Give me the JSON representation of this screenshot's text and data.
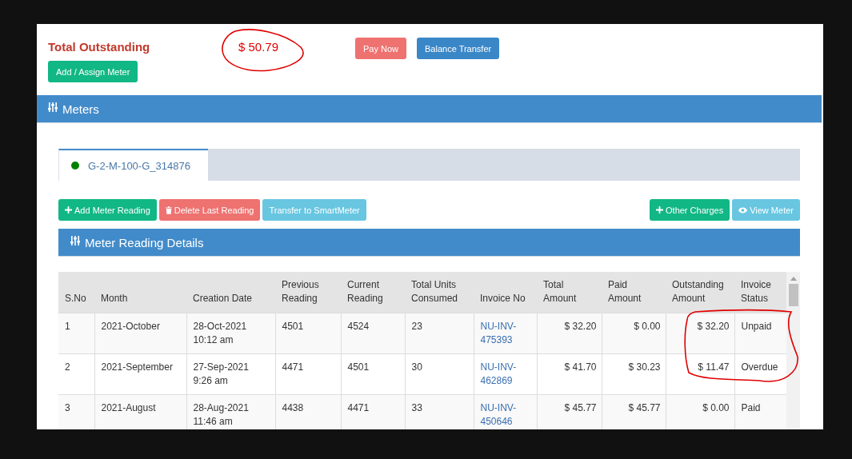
{
  "summary": {
    "label": "Total Outstanding",
    "amount": "$ 50.79"
  },
  "header_buttons": [
    {
      "label": "Pay Now",
      "kind": "danger"
    },
    {
      "label": "Balance Transfer",
      "kind": "primary"
    }
  ],
  "assign_button": "Add / Assign Meter",
  "meters_panel": {
    "title": "Meters"
  },
  "meter_tabs": [
    {
      "label": "G-2-M-100-G_314876",
      "selected": true,
      "color": "#008000"
    }
  ],
  "actions_left": [
    {
      "label": "Add Meter Reading",
      "kind": "success"
    },
    {
      "label": "Delete Last Reading",
      "kind": "danger"
    },
    {
      "label": "Transfer to SmartMeter",
      "kind": "info"
    }
  ],
  "actions_right": [
    {
      "label": "Other Charges",
      "kind": "success"
    },
    {
      "label": "View Meter",
      "kind": "info"
    }
  ],
  "details_panel": {
    "title": "Meter Reading Details"
  },
  "table": {
    "columns": [
      "S.No",
      "Month",
      "Creation Date",
      "Previous Reading",
      "Current Reading",
      "Total Units Consumed",
      "Invoice No",
      "Total Amount",
      "Paid Amount",
      "Outstanding Amount",
      "Invoice Status"
    ],
    "rows": [
      [
        "1",
        "2021-October",
        "28-Oct-2021 10:12 am",
        "4501",
        "4524",
        "23",
        "NU-INV-475393",
        "$ 32.20",
        "$ 0.00",
        "$ 32.20",
        "Unpaid"
      ],
      [
        "2",
        "2021-September",
        "27-Sep-2021 9:26 am",
        "4471",
        "4501",
        "30",
        "NU-INV-462869",
        "$ 41.70",
        "$ 30.23",
        "$ 11.47",
        "Overdue"
      ],
      [
        "3",
        "2021-August",
        "28-Aug-2021 11:46 am",
        "4438",
        "4471",
        "33",
        "NU-INV-450646",
        "$ 45.77",
        "$ 45.77",
        "$ 0.00",
        "Paid"
      ]
    ]
  }
}
